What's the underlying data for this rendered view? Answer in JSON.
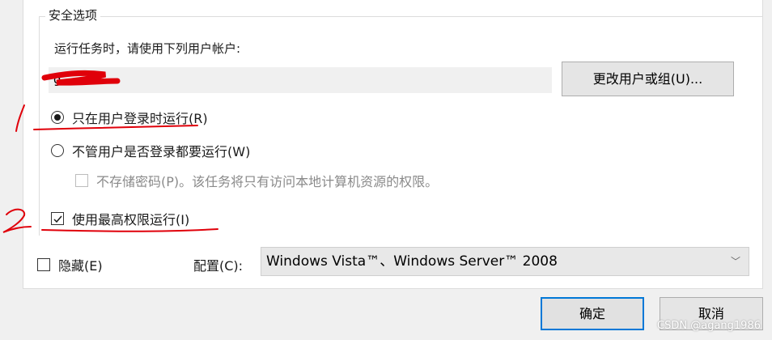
{
  "security": {
    "group_title": "安全选项",
    "run_as_label": "运行任务时，请使用下列用户帐户:",
    "user_value": "g",
    "change_user_button": "更改用户或组(U)...",
    "option_logged_on": "只在用户登录时运行(R)",
    "option_whether_logged_on": "不管用户是否登录都要运行(W)",
    "option_no_store_password": "不存储密码(P)。该任务将只有访问本地计算机资源的权限。",
    "option_highest_privileges": "使用最高权限运行(I)"
  },
  "bottom": {
    "hidden_label": "隐藏(E)",
    "configure_label": "配置(C):",
    "configure_value": "Windows Vista™、Windows Server™ 2008"
  },
  "dialog": {
    "ok_label": "确定",
    "cancel_label": "取消"
  },
  "watermark": "CSDN @agang1986",
  "annotations": {
    "mark_1": "1",
    "mark_2": "2",
    "ink_color": "#e0000a"
  },
  "state": {
    "logged_on_only_selected": true,
    "highest_privileges_checked": true,
    "hidden_checked": false,
    "no_store_password_enabled": false
  }
}
